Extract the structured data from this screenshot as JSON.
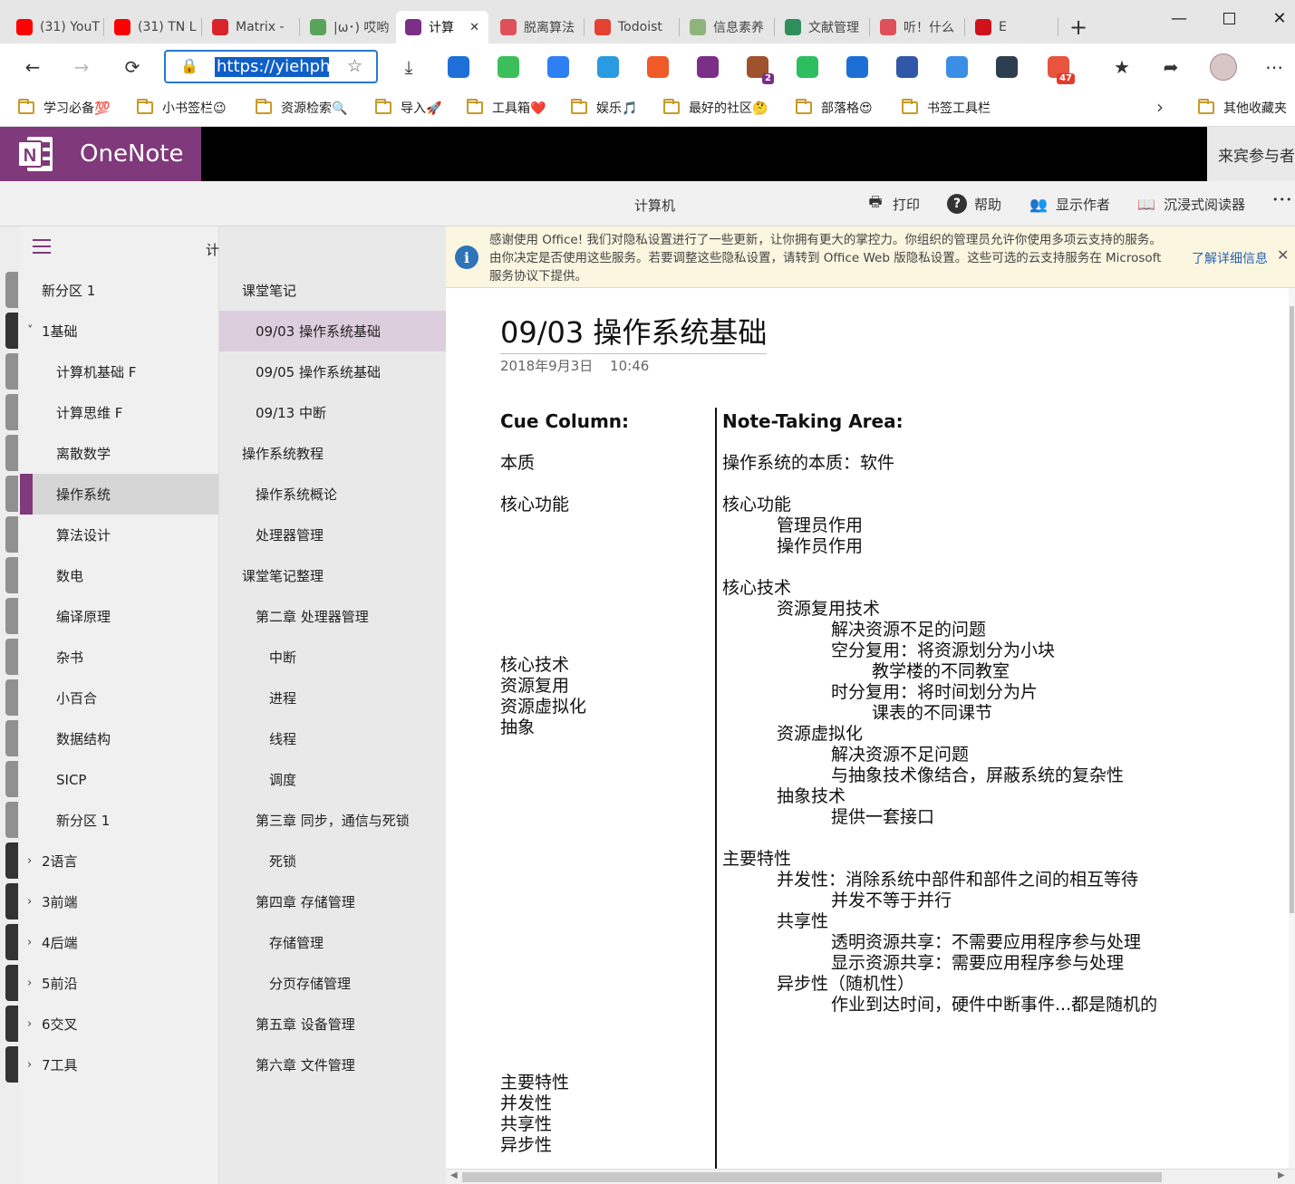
{
  "browser": {
    "tabs": [
      {
        "label": "(31) YouT",
        "icon": "youtube-icon",
        "color": "#ff0000"
      },
      {
        "label": "(31) TN L",
        "icon": "youtube-icon",
        "color": "#ff0000"
      },
      {
        "label": "Matrix - ",
        "icon": "matrix-icon",
        "color": "#d9232a"
      },
      {
        "label": "|ω･) 哎哟",
        "icon": "anime-icon",
        "color": "#5aa35a"
      },
      {
        "label": "计算",
        "icon": "onenote-icon",
        "color": "#7b2f87",
        "active": true
      },
      {
        "label": "脱离算法",
        "icon": "matrix-icon",
        "color": "#e0505a"
      },
      {
        "label": "Todoist",
        "icon": "todoist-icon",
        "color": "#e44232"
      },
      {
        "label": "信息素养",
        "icon": "grid-icon",
        "color": "#8fb47a"
      },
      {
        "label": "文献管理",
        "icon": "book-icon",
        "color": "#2e8f5c"
      },
      {
        "label": "听！什么",
        "icon": "matrix-icon",
        "color": "#e0505a"
      },
      {
        "label": "E",
        "icon": "netease-icon",
        "color": "#d0101a"
      }
    ],
    "close_tab_glyph": "✕",
    "new_tab_glyph": "+",
    "address": "https://yiehph",
    "extensions": [
      {
        "name": "translate-ext-icon",
        "color": "#1e6fd9",
        "badge": ""
      },
      {
        "name": "green-dot-ext-icon",
        "color": "#3cbf5a",
        "badge": ""
      },
      {
        "name": "blue-note-ext-icon",
        "color": "#2e7ff2",
        "badge": ""
      },
      {
        "name": "doc-ext-icon",
        "color": "#2a9be0",
        "badge": ""
      },
      {
        "name": "orange-ext-icon",
        "color": "#f05a28",
        "badge": ""
      },
      {
        "name": "onenote-ext-icon",
        "color": "#7b2f87",
        "badge": ""
      },
      {
        "name": "monkey-ext-icon",
        "color": "#a0522d",
        "badge": "2"
      },
      {
        "name": "evernote-ext-icon",
        "color": "#2dbe60",
        "badge": ""
      },
      {
        "name": "j-ext-icon",
        "color": "#1d6fd6",
        "badge": ""
      },
      {
        "name": "window-ext-icon",
        "color": "#3357a8",
        "badge": ""
      },
      {
        "name": "shield-ext-icon",
        "color": "#3a8ee6",
        "badge": ""
      },
      {
        "name": "spy-ext-icon",
        "color": "#2c3e50",
        "badge": ""
      },
      {
        "name": "apps-ext-icon",
        "color": "#e8543f",
        "badge": "47"
      }
    ],
    "bookmarks": [
      {
        "label": "学习必备💯"
      },
      {
        "label": "小书签栏😉"
      },
      {
        "label": "资源检索🔍"
      },
      {
        "label": "导入🚀"
      },
      {
        "label": "工具箱❤️"
      },
      {
        "label": "娱乐🎵"
      },
      {
        "label": "最好的社区🤔"
      },
      {
        "label": "部落格😍"
      },
      {
        "label": "书签工具栏"
      }
    ],
    "other_bookmarks": "其他收藏夹"
  },
  "onenote": {
    "brand": "OneNote",
    "guest": "来宾参与者",
    "notebook_title": "计算机",
    "commands": [
      {
        "label": "打印",
        "icon": "printer-icon"
      },
      {
        "label": "帮助",
        "icon": "help-icon"
      },
      {
        "label": "显示作者",
        "icon": "people-icon"
      },
      {
        "label": "沉浸式阅读器",
        "icon": "reader-icon"
      }
    ],
    "more_glyph": "•••",
    "nav_title": "计算机",
    "sections": [
      {
        "label": "新分区 1",
        "level": 0,
        "chev": ""
      },
      {
        "label": "1基础",
        "level": 0,
        "chev": "˅"
      },
      {
        "label": "计算机基础 F",
        "level": 1,
        "chev": ""
      },
      {
        "label": "计算思维 F",
        "level": 1,
        "chev": ""
      },
      {
        "label": "离散数学",
        "level": 1,
        "chev": ""
      },
      {
        "label": "操作系统",
        "level": 1,
        "chev": "",
        "active": true
      },
      {
        "label": "算法设计",
        "level": 1,
        "chev": ""
      },
      {
        "label": "数电",
        "level": 1,
        "chev": ""
      },
      {
        "label": "编译原理",
        "level": 1,
        "chev": ""
      },
      {
        "label": "杂书",
        "level": 1,
        "chev": ""
      },
      {
        "label": "小百合",
        "level": 1,
        "chev": ""
      },
      {
        "label": "数据结构",
        "level": 1,
        "chev": ""
      },
      {
        "label": "SICP",
        "level": 1,
        "chev": ""
      },
      {
        "label": "新分区 1",
        "level": 1,
        "chev": ""
      },
      {
        "label": "2语言",
        "level": 0,
        "chev": "›"
      },
      {
        "label": "3前端",
        "level": 0,
        "chev": "›"
      },
      {
        "label": "4后端",
        "level": 0,
        "chev": "›"
      },
      {
        "label": "5前沿",
        "level": 0,
        "chev": "›"
      },
      {
        "label": "6交叉",
        "level": 0,
        "chev": "›"
      },
      {
        "label": "7工具",
        "level": 0,
        "chev": "›"
      }
    ],
    "pages": [
      {
        "label": "课堂笔记",
        "level": 0
      },
      {
        "label": "09/03 操作系统基础",
        "level": 1,
        "active": true
      },
      {
        "label": "09/05 操作系统基础",
        "level": 1
      },
      {
        "label": "09/13 中断",
        "level": 1
      },
      {
        "label": "操作系统教程",
        "level": 0
      },
      {
        "label": "操作系统概论",
        "level": 1
      },
      {
        "label": "处理器管理",
        "level": 1
      },
      {
        "label": "课堂笔记整理",
        "level": 0
      },
      {
        "label": "第二章 处理器管理",
        "level": 1
      },
      {
        "label": "中断",
        "level": 2
      },
      {
        "label": "进程",
        "level": 2
      },
      {
        "label": "线程",
        "level": 2
      },
      {
        "label": "调度",
        "level": 2
      },
      {
        "label": "第三章 同步，通信与死锁",
        "level": 1
      },
      {
        "label": "死锁",
        "level": 2
      },
      {
        "label": "第四章 存储管理",
        "level": 1
      },
      {
        "label": "存储管理",
        "level": 2
      },
      {
        "label": "分页存储管理",
        "level": 2
      },
      {
        "label": "第五章 设备管理",
        "level": 1
      },
      {
        "label": "第六章 文件管理",
        "level": 1
      }
    ],
    "notice": {
      "text": "感谢使用 Office! 我们对隐私设置进行了一些更新，让你拥有更大的掌控力。你组织的管理员允许你使用多项云支持的服务。由你决定是否使用这些服务。若要调整这些隐私设置，请转到 Office Web 版隐私设置。这些可选的云支持服务在 Microsoft 服务协议下提供。",
      "link": "了解详细信息",
      "close": "✕"
    },
    "note": {
      "title": "09/03 操作系统基础",
      "date": "2018年9月3日",
      "time": "10:46",
      "cue_header": "Cue Column:",
      "notes_header": "Note-Taking Area:",
      "cue_items": [
        "本质",
        "核心功能",
        "核心技术",
        "资源复用",
        "资源虚拟化",
        "抽象",
        "主要特性",
        "并发性",
        "共享性",
        "异步性"
      ],
      "note_lines": [
        "操作系统的本质：软件",
        "核心功能",
        "管理员作用",
        "操作员作用",
        "核心技术",
        "资源复用技术",
        "解决资源不足的问题",
        "空分复用：将资源划分为小块",
        "教学楼的不同教室",
        "时分复用：将时间划分为片",
        "课表的不同课节",
        "资源虚拟化",
        "解决资源不足问题",
        "与抽象技术像结合，屏蔽系统的复杂性",
        "抽象技术",
        "提供一套接口",
        "主要特性",
        "并发性：消除系统中部件和部件之间的相互等待",
        "并发不等于并行",
        "共享性",
        "透明资源共享：不需要应用程序参与处理",
        "显示资源共享：需要应用程序参与处理",
        "异步性（随机性）",
        "作业到达时间，硬件中断事件...都是随机的"
      ]
    }
  }
}
